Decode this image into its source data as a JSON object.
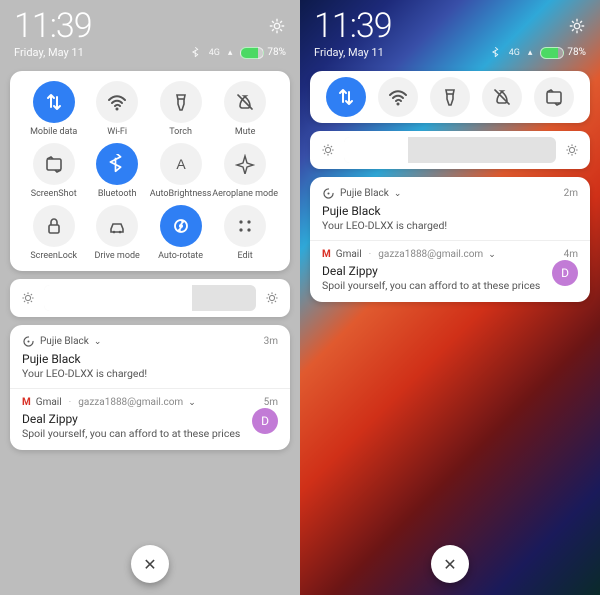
{
  "colors": {
    "accent": "#2f7ff4",
    "avatar": "#c27bd6",
    "gmail": "#d93025"
  },
  "left": {
    "time": "11:39",
    "date": "Friday, May 11",
    "signal": "4G",
    "battery_pct": "78%",
    "qs": [
      {
        "key": "mobile-data",
        "label": "Mobile data",
        "active": true
      },
      {
        "key": "wifi",
        "label": "Wi-Fi",
        "active": false
      },
      {
        "key": "torch",
        "label": "Torch",
        "active": false
      },
      {
        "key": "mute",
        "label": "Mute",
        "active": false
      },
      {
        "key": "screenshot",
        "label": "ScreenShot",
        "active": false
      },
      {
        "key": "bluetooth",
        "label": "Bluetooth",
        "active": true
      },
      {
        "key": "auto-brightness",
        "label": "AutoBrightness",
        "active": false
      },
      {
        "key": "aeroplane",
        "label": "Aeroplane mode",
        "active": false
      },
      {
        "key": "screen-lock",
        "label": "ScreenLock",
        "active": false
      },
      {
        "key": "drive-mode",
        "label": "Drive mode",
        "active": false
      },
      {
        "key": "auto-rotate",
        "label": "Auto-rotate",
        "active": true
      },
      {
        "key": "edit",
        "label": "Edit",
        "active": false
      }
    ],
    "brightness_pct": 70,
    "notifications": [
      {
        "app": "Pujie Black",
        "icon": "pujie-icon",
        "time": "3m",
        "title": "Pujie Black",
        "body": "Your LEO-DLXX is charged!"
      },
      {
        "app": "Gmail",
        "icon": "gmail-icon",
        "from": "gazza1888@gmail.com",
        "time": "5m",
        "title": "Deal Zippy",
        "body": "Spoil yourself, you can afford to at these prices",
        "avatar_initial": "D"
      }
    ]
  },
  "right": {
    "time": "11:39",
    "date": "Friday, May 11",
    "signal": "4G",
    "battery_pct": "78%",
    "qs": [
      {
        "key": "mobile-data",
        "active": true
      },
      {
        "key": "wifi",
        "active": false
      },
      {
        "key": "torch",
        "active": false
      },
      {
        "key": "mute",
        "active": false
      },
      {
        "key": "screenshot",
        "active": false
      }
    ],
    "brightness_pct": 30,
    "notifications": [
      {
        "app": "Pujie Black",
        "icon": "pujie-icon",
        "time": "2m",
        "title": "Pujie Black",
        "body": "Your LEO-DLXX is charged!"
      },
      {
        "app": "Gmail",
        "icon": "gmail-icon",
        "from": "gazza1888@gmail.com",
        "time": "4m",
        "title": "Deal Zippy",
        "body": "Spoil yourself, you can afford to at these prices",
        "avatar_initial": "D"
      }
    ]
  }
}
